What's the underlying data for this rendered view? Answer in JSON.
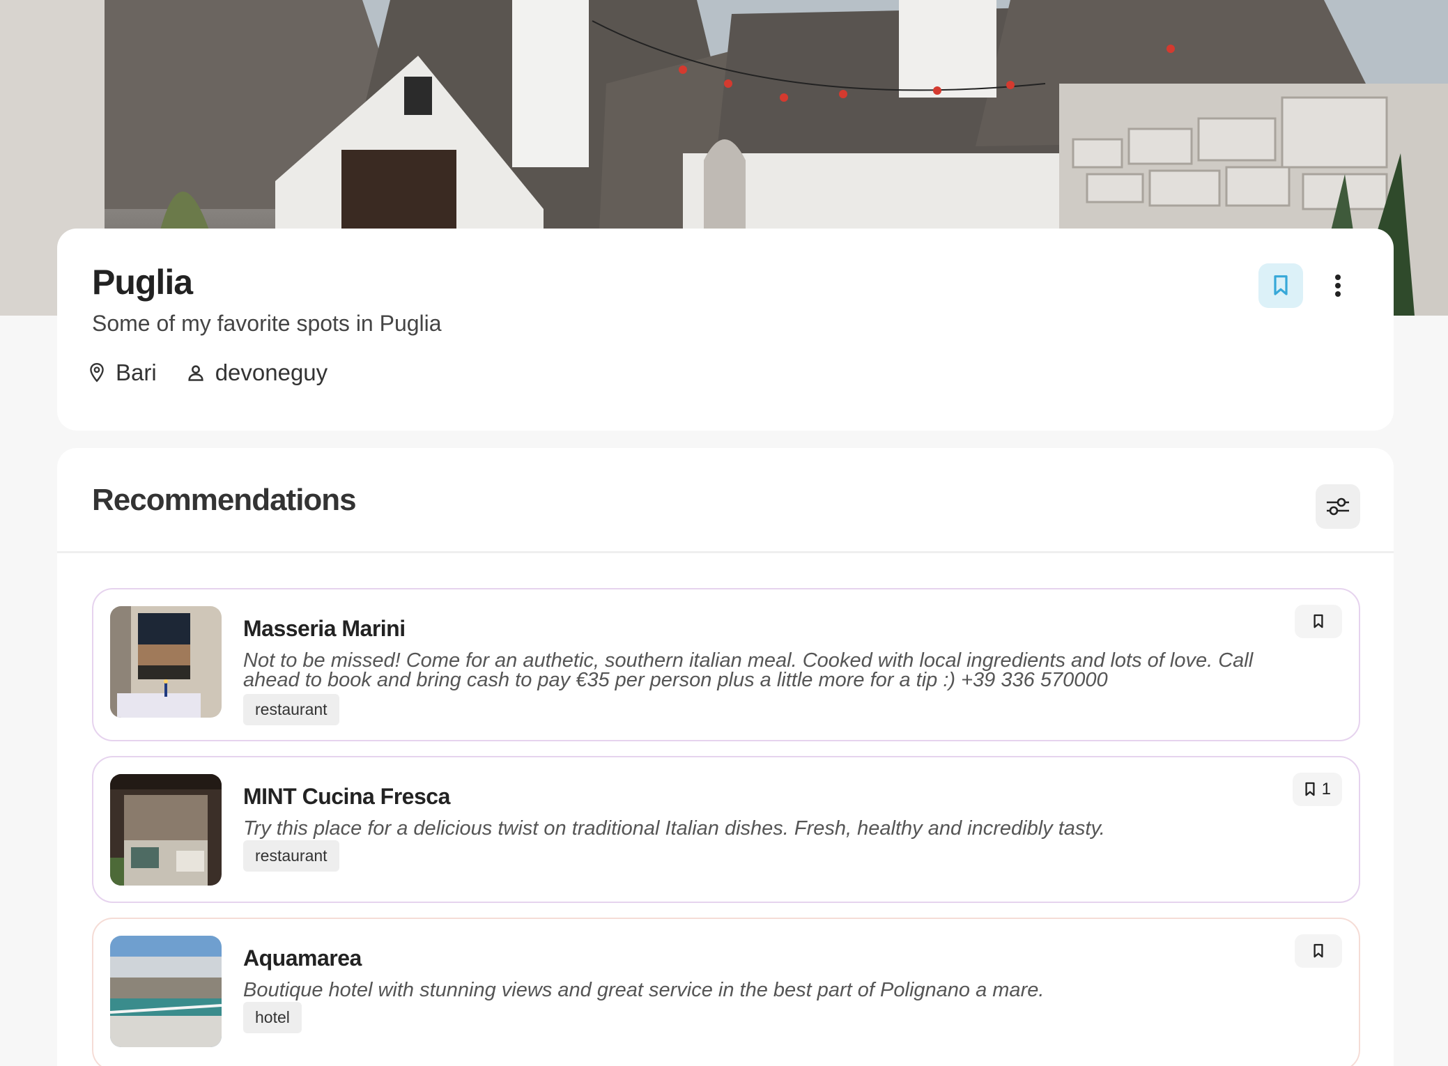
{
  "header": {
    "title": "Puglia",
    "subtitle": "Some of my favorite spots in Puglia",
    "location": "Bari",
    "author": "devoneguy"
  },
  "recommendations": {
    "title": "Recommendations",
    "items": [
      {
        "name": "Masseria Marini",
        "description": "Not to be missed! Come for an authetic, southern italian meal. Cooked with local ingredients and lots of love. Call ahead to book and bring cash to pay €35 per person plus a little more for a tip :) +39 336 570000",
        "tag": "restaurant",
        "save_count": ""
      },
      {
        "name": "MINT Cucina Fresca",
        "description": "Try this place for a delicious twist on traditional Italian dishes. Fresh, healthy and incredibly tasty.",
        "tag": "restaurant",
        "save_count": "1"
      },
      {
        "name": "Aquamarea",
        "description": "Boutique hotel with stunning views and great service in the best part of Polignano a mare.",
        "tag": "hotel",
        "save_count": ""
      }
    ]
  },
  "colors": {
    "bookmark_active_bg": "#dcf1f8",
    "bookmark_active_icon": "#37a8d8",
    "restaurant_border": "#e6d3ee",
    "hotel_border": "#f5dcd6"
  }
}
